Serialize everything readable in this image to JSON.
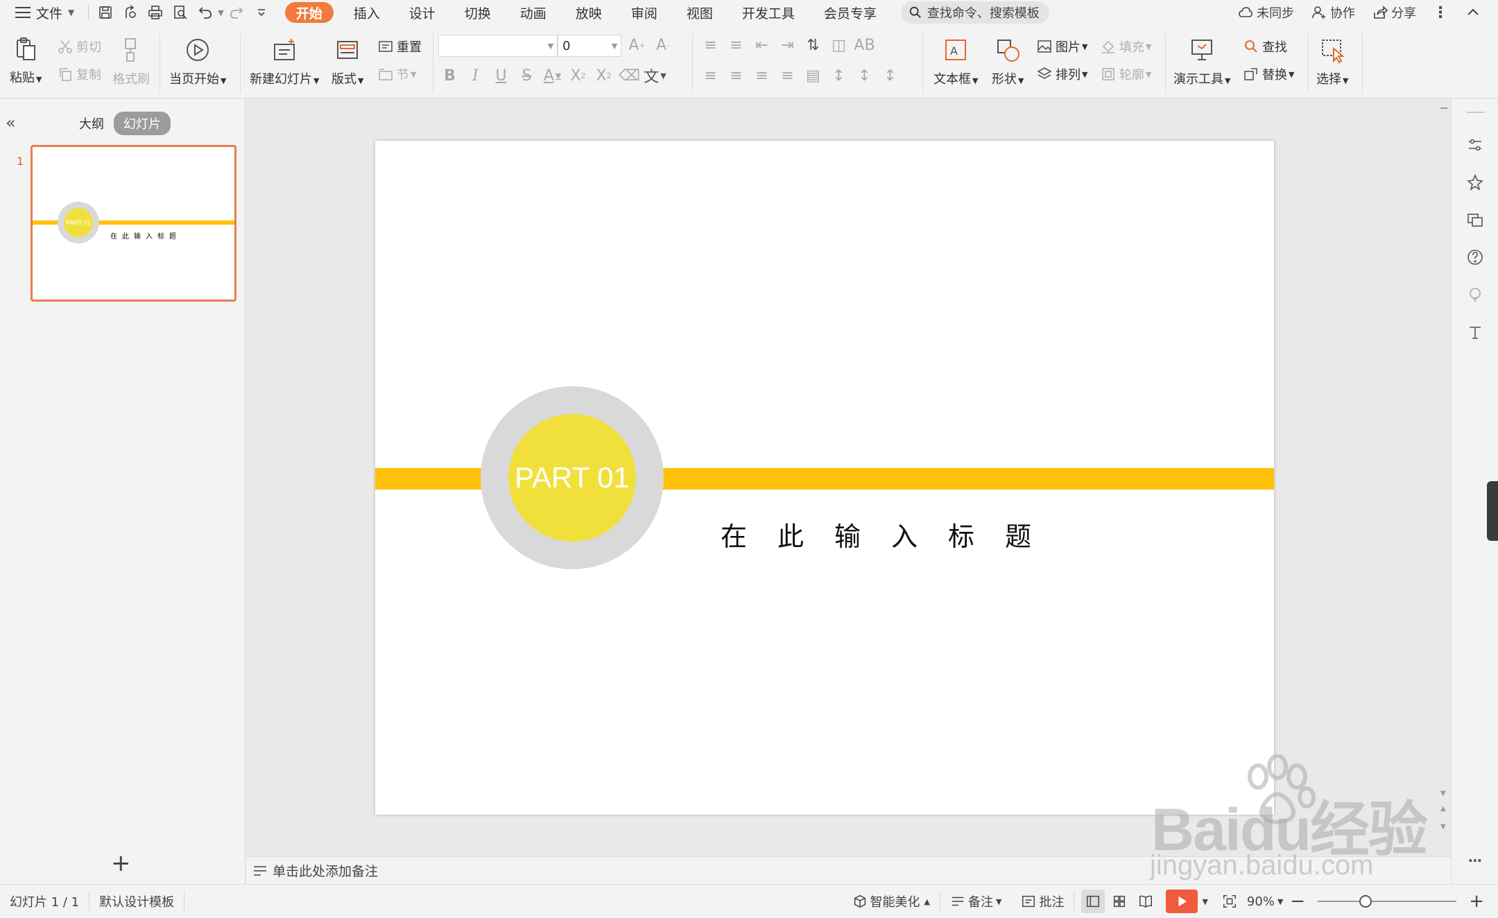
{
  "menubar": {
    "file_label": "文件",
    "tabs": [
      "开始",
      "插入",
      "设计",
      "切换",
      "动画",
      "放映",
      "审阅",
      "视图",
      "开发工具",
      "会员专享"
    ],
    "active_tab": "开始",
    "search_placeholder": "查找命令、搜索模板",
    "sync_label": "未同步",
    "collab_label": "协作",
    "share_label": "分享"
  },
  "ribbon": {
    "paste": "粘贴",
    "cut": "剪切",
    "copy": "复制",
    "format_painter": "格式刷",
    "from_current": "当页开始",
    "new_slide": "新建幻灯片",
    "layout": "版式",
    "reset": "重置",
    "section": "节",
    "font_size_value": "0",
    "text_box": "文本框",
    "shape": "形状",
    "picture": "图片",
    "fill": "填充",
    "arrange": "排列",
    "outline": "轮廓",
    "present_tools": "演示工具",
    "find": "查找",
    "replace": "替换",
    "select": "选择"
  },
  "left_panel": {
    "tab_outline": "大纲",
    "tab_slides": "幻灯片",
    "slide_number": "1",
    "add_button": "+"
  },
  "slide": {
    "badge_text": "PART 01",
    "title": "在此输入标题"
  },
  "notes": {
    "placeholder": "单击此处添加备注"
  },
  "status": {
    "slide_counter": "幻灯片 1 / 1",
    "template": "默认设计模板",
    "beautify": "智能美化",
    "notes": "备注",
    "comments": "批注",
    "zoom": "90%",
    "zoom_level": 0.33
  },
  "watermark": {
    "brand": "Baidu经验",
    "url": "jingyan.baidu.com"
  },
  "colors": {
    "accent_tab": "#f07b3b",
    "stripe": "#ffc107",
    "ring": "#d9d9d9",
    "core": "#f1e03c",
    "play": "#f05b3c"
  },
  "icons": {
    "qa": [
      "save-icon",
      "export-pdf-icon",
      "print-icon",
      "print-preview-icon",
      "undo-icon",
      "redo-icon",
      "customize-icon"
    ],
    "right_sidebar": [
      "properties-icon",
      "animation-pin-icon",
      "slide-switch-icon",
      "help-icon",
      "idea-icon",
      "text-icon",
      "more-icon"
    ]
  }
}
